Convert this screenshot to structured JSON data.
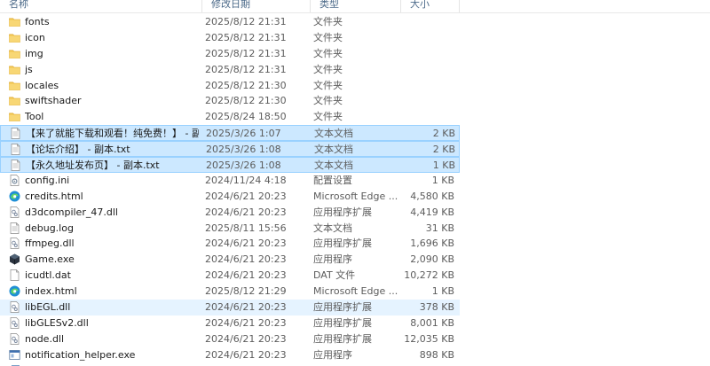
{
  "header": {
    "name": "名称",
    "date": "修改日期",
    "type": "类型",
    "size": "大小"
  },
  "rows": [
    {
      "name": "fonts",
      "date": "2025/8/12 21:31",
      "type": "文件夹",
      "size": "",
      "icon": "folder-icon",
      "state": ""
    },
    {
      "name": "icon",
      "date": "2025/8/12 21:31",
      "type": "文件夹",
      "size": "",
      "icon": "folder-icon",
      "state": ""
    },
    {
      "name": "img",
      "date": "2025/8/12 21:31",
      "type": "文件夹",
      "size": "",
      "icon": "folder-icon",
      "state": ""
    },
    {
      "name": "js",
      "date": "2025/8/12 21:31",
      "type": "文件夹",
      "size": "",
      "icon": "folder-icon",
      "state": ""
    },
    {
      "name": "locales",
      "date": "2025/8/12 21:30",
      "type": "文件夹",
      "size": "",
      "icon": "folder-icon",
      "state": ""
    },
    {
      "name": "swiftshader",
      "date": "2025/8/12 21:30",
      "type": "文件夹",
      "size": "",
      "icon": "folder-icon",
      "state": ""
    },
    {
      "name": "Tool",
      "date": "2025/8/24 18:50",
      "type": "文件夹",
      "size": "",
      "icon": "folder-icon",
      "state": ""
    },
    {
      "name": "【来了就能下载和观看！纯免费！】 - 副...",
      "date": "2025/3/26 1:07",
      "type": "文本文档",
      "size": "2 KB",
      "icon": "text-file-icon",
      "state": "sel"
    },
    {
      "name": "【论坛介绍】 - 副本.txt",
      "date": "2025/3/26 1:08",
      "type": "文本文档",
      "size": "2 KB",
      "icon": "text-file-icon",
      "state": "sel"
    },
    {
      "name": "【永久地址发布页】 - 副本.txt",
      "date": "2025/3/26 1:08",
      "type": "文本文档",
      "size": "1 KB",
      "icon": "text-file-icon",
      "state": "sel"
    },
    {
      "name": "config.ini",
      "date": "2024/11/24 4:18",
      "type": "配置设置",
      "size": "1 KB",
      "icon": "config-file-icon",
      "state": ""
    },
    {
      "name": "credits.html",
      "date": "2024/6/21 20:23",
      "type": "Microsoft Edge ...",
      "size": "4,580 KB",
      "icon": "edge-icon",
      "state": ""
    },
    {
      "name": "d3dcompiler_47.dll",
      "date": "2024/6/21 20:23",
      "type": "应用程序扩展",
      "size": "4,419 KB",
      "icon": "dll-file-icon",
      "state": ""
    },
    {
      "name": "debug.log",
      "date": "2025/8/11 15:56",
      "type": "文本文档",
      "size": "31 KB",
      "icon": "text-file-icon",
      "state": ""
    },
    {
      "name": "ffmpeg.dll",
      "date": "2024/6/21 20:23",
      "type": "应用程序扩展",
      "size": "1,696 KB",
      "icon": "dll-file-icon",
      "state": ""
    },
    {
      "name": "Game.exe",
      "date": "2024/6/21 20:23",
      "type": "应用程序",
      "size": "2,090 KB",
      "icon": "game-exe-icon",
      "state": ""
    },
    {
      "name": "icudtl.dat",
      "date": "2024/6/21 20:23",
      "type": "DAT 文件",
      "size": "10,272 KB",
      "icon": "blank-file-icon",
      "state": ""
    },
    {
      "name": "index.html",
      "date": "2025/8/12 21:29",
      "type": "Microsoft Edge ...",
      "size": "1 KB",
      "icon": "edge-icon",
      "state": ""
    },
    {
      "name": "libEGL.dll",
      "date": "2024/6/21 20:23",
      "type": "应用程序扩展",
      "size": "378 KB",
      "icon": "dll-file-icon",
      "state": "hl"
    },
    {
      "name": "libGLESv2.dll",
      "date": "2024/6/21 20:23",
      "type": "应用程序扩展",
      "size": "8,001 KB",
      "icon": "dll-file-icon",
      "state": ""
    },
    {
      "name": "node.dll",
      "date": "2024/6/21 20:23",
      "type": "应用程序扩展",
      "size": "12,035 KB",
      "icon": "dll-file-icon",
      "state": ""
    },
    {
      "name": "notification_helper.exe",
      "date": "2024/6/21 20:23",
      "type": "应用程序",
      "size": "898 KB",
      "icon": "exe-icon",
      "state": ""
    }
  ]
}
